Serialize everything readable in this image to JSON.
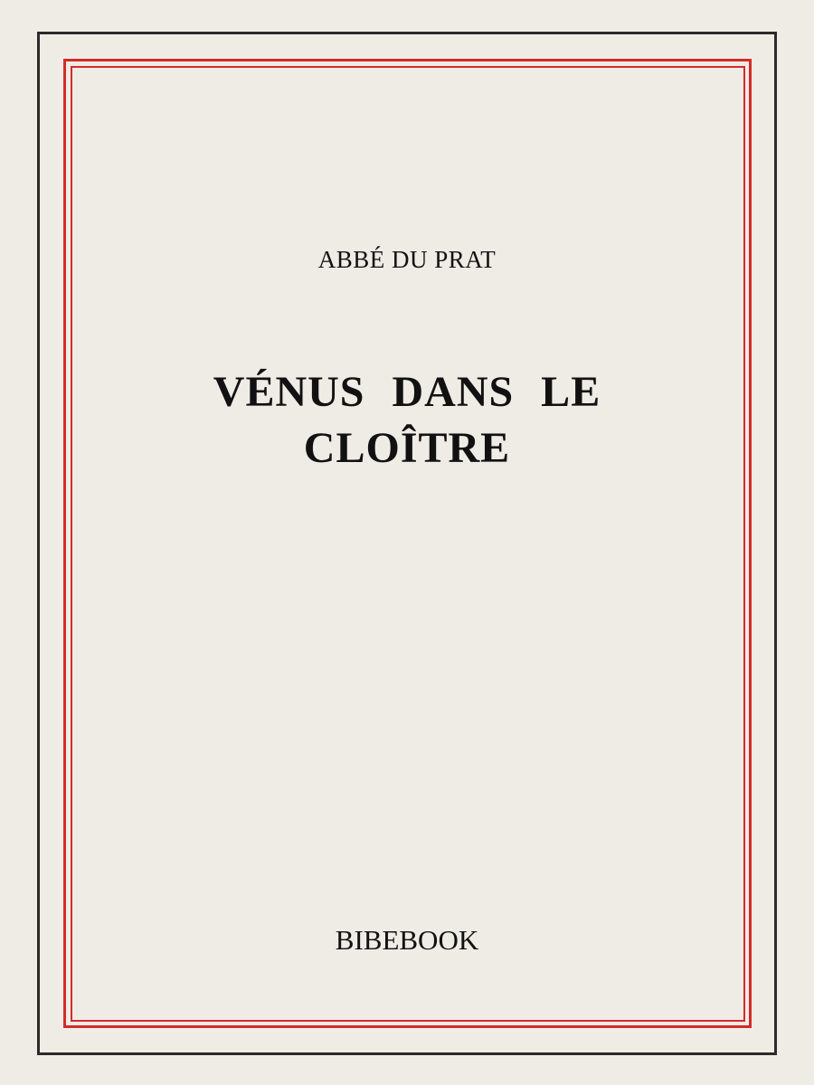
{
  "cover": {
    "author": "ABBÉ DU PRAT",
    "title_words_line1": [
      "VÉNUS",
      "DANS",
      "LE"
    ],
    "title_line2": "CLOÎTRE",
    "publisher": "BIBEBOOK"
  },
  "colors": {
    "background": "#efece6",
    "outer_border": "#2b2b2b",
    "red_border": "#d42a2a",
    "text": "#111111"
  }
}
